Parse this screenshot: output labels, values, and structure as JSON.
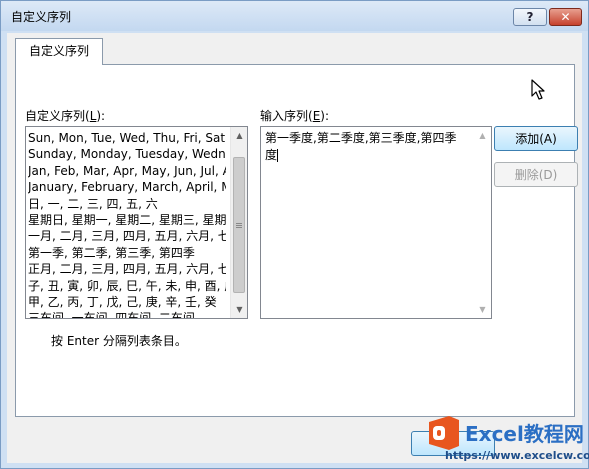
{
  "window": {
    "title": "自定义序列"
  },
  "titlebar": {
    "help_label": "?",
    "close_label": "✕"
  },
  "tabs": [
    {
      "label": "自定义序列"
    }
  ],
  "custom_lists": {
    "label": "自定义序列(L):",
    "label_prefix": "自定义序列(",
    "label_accel": "L",
    "label_suffix": "):",
    "items": [
      {
        "text": "Sun, Mon, Tue, Wed, Thu, Fri, Sat",
        "selected": false
      },
      {
        "text": "Sunday, Monday, Tuesday, Wednesday, Thursday, Friday, Saturday",
        "selected": false
      },
      {
        "text": "Jan, Feb, Mar, Apr, May, Jun, Jul, Aug, Sep, Oct, Nov, Dec",
        "selected": false
      },
      {
        "text": "January, February, March, April, May, June, July, August, September, October, November, December",
        "selected": false
      },
      {
        "text": "日, 一, 二, 三, 四, 五, 六",
        "selected": false
      },
      {
        "text": "星期日, 星期一, 星期二, 星期三, 星期四, 星期五, 星期六",
        "selected": false
      },
      {
        "text": "一月, 二月, 三月, 四月, 五月, 六月, 七月, 八月, 九月, 十月, 十一月, 十二月",
        "selected": false
      },
      {
        "text": "第一季, 第二季, 第三季, 第四季",
        "selected": false
      },
      {
        "text": "正月, 二月, 三月, 四月, 五月, 六月, 七月, 八月, 九月, 十月, 十一月, 腊月",
        "selected": false
      },
      {
        "text": "子, 丑, 寅, 卯, 辰, 巳, 午, 未, 申, 酉, 戌, 亥",
        "selected": false
      },
      {
        "text": "甲, 乙, 丙, 丁, 戊, 己, 庚, 辛, 壬, 癸",
        "selected": false
      },
      {
        "text": "三车间, 一车间, 四车间, 二车间",
        "selected": false
      },
      {
        "text": "",
        "selected": true
      }
    ]
  },
  "list_entries": {
    "label": "输入序列(E):",
    "label_prefix": "输入序列(",
    "label_accel": "E",
    "label_suffix": "):",
    "value": "第一季度,第二季度,第三季度,第四季度"
  },
  "buttons": {
    "add": "添加(A)",
    "delete": "删除(D)"
  },
  "hint": "按 Enter 分隔列表条目。",
  "watermark": {
    "brand": "Excel教程网",
    "url": "https://www.excelcw.com"
  },
  "colors": {
    "selection": "#3399ff",
    "primary_button": "#bee6fd"
  }
}
